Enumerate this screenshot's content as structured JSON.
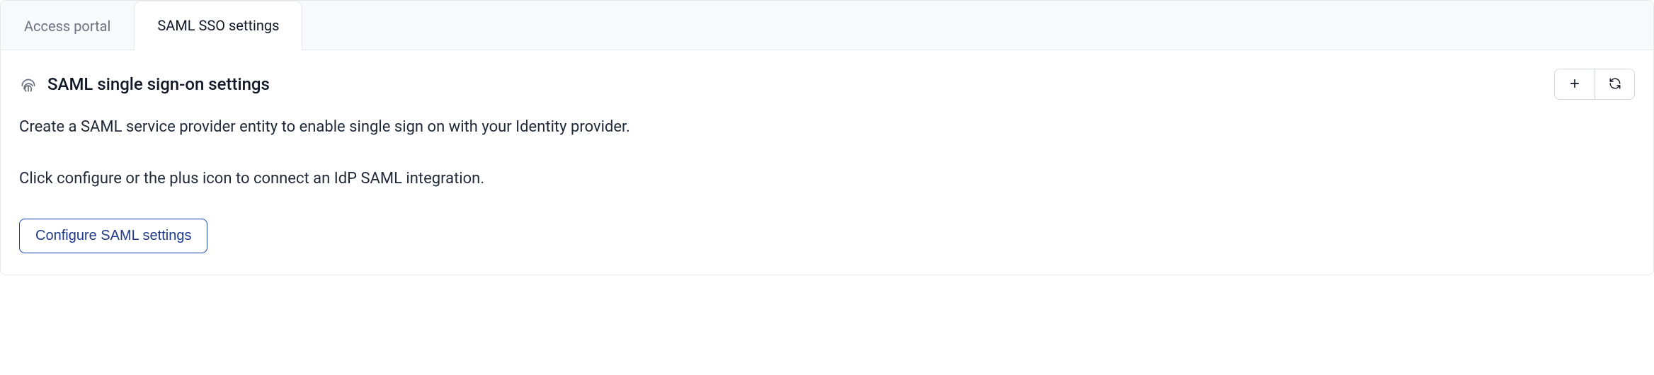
{
  "tabs": [
    {
      "label": "Access portal",
      "active": false
    },
    {
      "label": "SAML SSO settings",
      "active": true
    }
  ],
  "panel": {
    "title": "SAML single sign-on settings",
    "description": "Create a SAML service provider entity to enable single sign on with your Identity provider.",
    "instruction": "Click configure or the plus icon to connect an IdP SAML integration.",
    "configure_button": "Configure SAML settings"
  },
  "actions": {
    "add": "Add",
    "refresh": "Refresh"
  }
}
